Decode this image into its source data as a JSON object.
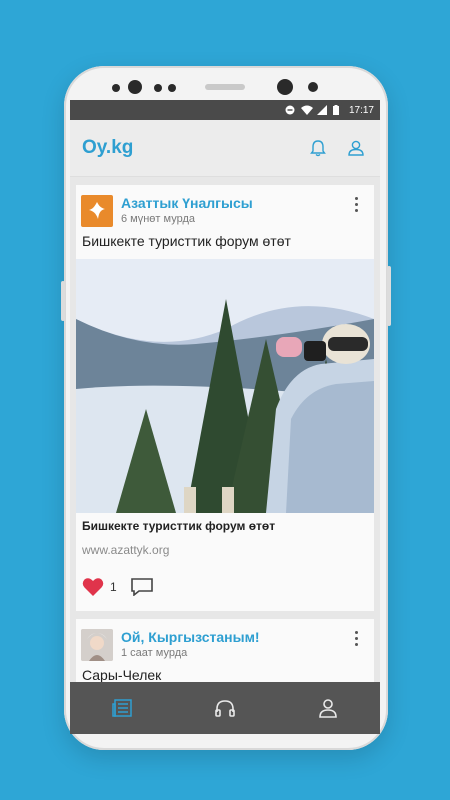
{
  "status": {
    "time": "17:17"
  },
  "app": {
    "title": "Oy.kg"
  },
  "posts": [
    {
      "source": "Азаттык Үналгысы",
      "time": "6 мүнөт мурда",
      "text": "Бишкекте туристтик форум өтөт",
      "link_title": "Бишкекте туристтик форум өтөт",
      "link_url": "www.azattyk.org",
      "likes": "1"
    },
    {
      "source": "Ой, Кыргызстаным!",
      "time": "1 саат мурда",
      "text": "Сары-Челек"
    }
  ],
  "icons": {
    "appbar": [
      "bell-icon",
      "profile-icon"
    ],
    "post": [
      "heart-icon",
      "comment-icon",
      "more-vert-icon"
    ],
    "nav": [
      "news-feed-icon",
      "headphones-icon",
      "user-icon"
    ]
  },
  "colors": {
    "background": "#2ea6d6",
    "accent": "#2e9fd1",
    "like": "#e0344b",
    "statusbar": "#4a4a4a",
    "bottomnav": "#555555"
  }
}
